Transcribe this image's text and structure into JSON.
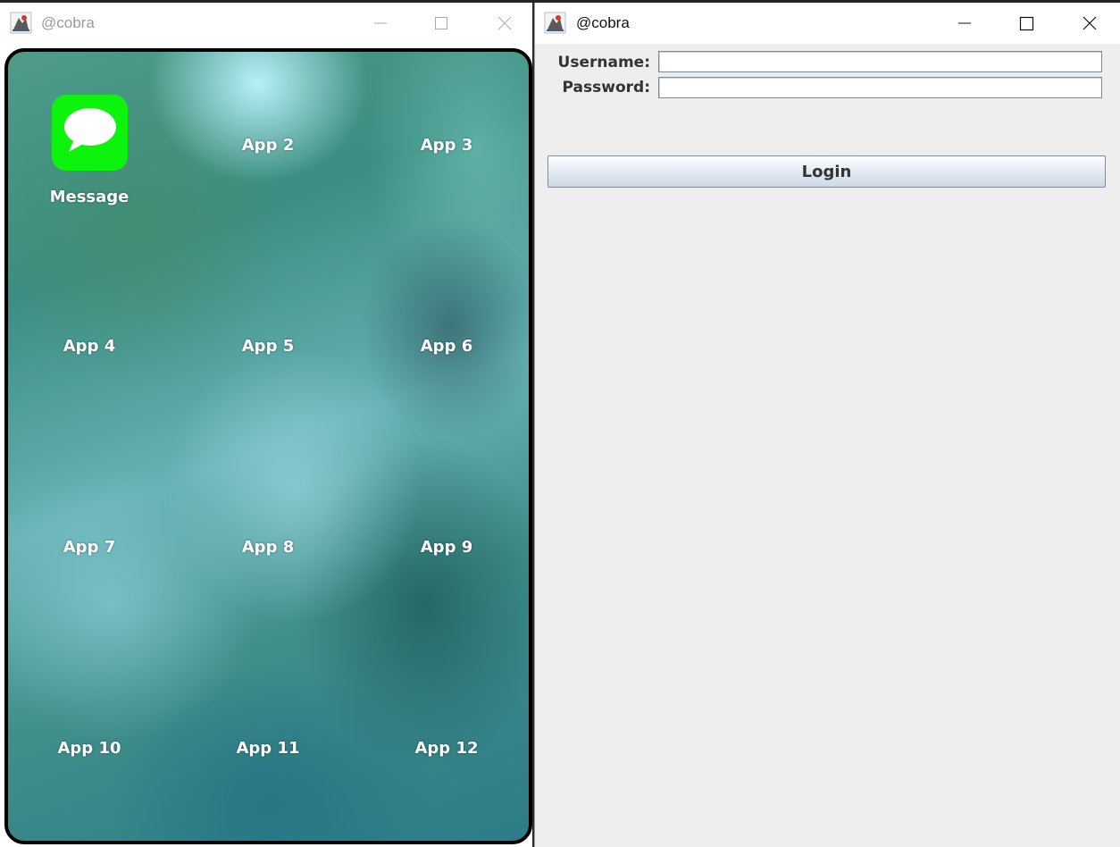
{
  "phone_window": {
    "title": "@cobra",
    "message_app_label": "Message",
    "apps": [
      "App 2",
      "App 3",
      "App 4",
      "App 5",
      "App 6",
      "App 7",
      "App 8",
      "App 9",
      "App 10",
      "App 11",
      "App 12"
    ]
  },
  "login_window": {
    "title": "@cobra",
    "username_label": "Username:",
    "password_label": "Password:",
    "username_value": "",
    "password_value": "",
    "login_label": "Login"
  },
  "colors": {
    "message_icon_bg": "#0df30d",
    "phone_border": "#000000",
    "form_background": "#eeeeee"
  },
  "icons": [
    "java-app-icon",
    "minimize-icon",
    "maximize-icon",
    "close-icon",
    "speech-bubble-icon"
  ]
}
